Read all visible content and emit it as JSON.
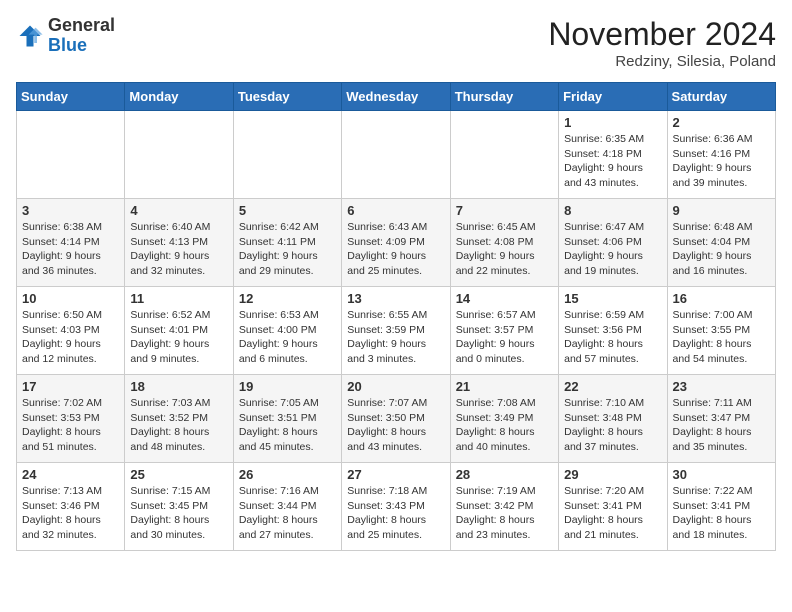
{
  "header": {
    "logo": {
      "general": "General",
      "blue": "Blue"
    },
    "title": "November 2024",
    "location": "Redziny, Silesia, Poland"
  },
  "calendar": {
    "days_of_week": [
      "Sunday",
      "Monday",
      "Tuesday",
      "Wednesday",
      "Thursday",
      "Friday",
      "Saturday"
    ],
    "weeks": [
      [
        {
          "day": "",
          "info": ""
        },
        {
          "day": "",
          "info": ""
        },
        {
          "day": "",
          "info": ""
        },
        {
          "day": "",
          "info": ""
        },
        {
          "day": "",
          "info": ""
        },
        {
          "day": "1",
          "info": "Sunrise: 6:35 AM\nSunset: 4:18 PM\nDaylight: 9 hours\nand 43 minutes."
        },
        {
          "day": "2",
          "info": "Sunrise: 6:36 AM\nSunset: 4:16 PM\nDaylight: 9 hours\nand 39 minutes."
        }
      ],
      [
        {
          "day": "3",
          "info": "Sunrise: 6:38 AM\nSunset: 4:14 PM\nDaylight: 9 hours\nand 36 minutes."
        },
        {
          "day": "4",
          "info": "Sunrise: 6:40 AM\nSunset: 4:13 PM\nDaylight: 9 hours\nand 32 minutes."
        },
        {
          "day": "5",
          "info": "Sunrise: 6:42 AM\nSunset: 4:11 PM\nDaylight: 9 hours\nand 29 minutes."
        },
        {
          "day": "6",
          "info": "Sunrise: 6:43 AM\nSunset: 4:09 PM\nDaylight: 9 hours\nand 25 minutes."
        },
        {
          "day": "7",
          "info": "Sunrise: 6:45 AM\nSunset: 4:08 PM\nDaylight: 9 hours\nand 22 minutes."
        },
        {
          "day": "8",
          "info": "Sunrise: 6:47 AM\nSunset: 4:06 PM\nDaylight: 9 hours\nand 19 minutes."
        },
        {
          "day": "9",
          "info": "Sunrise: 6:48 AM\nSunset: 4:04 PM\nDaylight: 9 hours\nand 16 minutes."
        }
      ],
      [
        {
          "day": "10",
          "info": "Sunrise: 6:50 AM\nSunset: 4:03 PM\nDaylight: 9 hours\nand 12 minutes."
        },
        {
          "day": "11",
          "info": "Sunrise: 6:52 AM\nSunset: 4:01 PM\nDaylight: 9 hours\nand 9 minutes."
        },
        {
          "day": "12",
          "info": "Sunrise: 6:53 AM\nSunset: 4:00 PM\nDaylight: 9 hours\nand 6 minutes."
        },
        {
          "day": "13",
          "info": "Sunrise: 6:55 AM\nSunset: 3:59 PM\nDaylight: 9 hours\nand 3 minutes."
        },
        {
          "day": "14",
          "info": "Sunrise: 6:57 AM\nSunset: 3:57 PM\nDaylight: 9 hours\nand 0 minutes."
        },
        {
          "day": "15",
          "info": "Sunrise: 6:59 AM\nSunset: 3:56 PM\nDaylight: 8 hours\nand 57 minutes."
        },
        {
          "day": "16",
          "info": "Sunrise: 7:00 AM\nSunset: 3:55 PM\nDaylight: 8 hours\nand 54 minutes."
        }
      ],
      [
        {
          "day": "17",
          "info": "Sunrise: 7:02 AM\nSunset: 3:53 PM\nDaylight: 8 hours\nand 51 minutes."
        },
        {
          "day": "18",
          "info": "Sunrise: 7:03 AM\nSunset: 3:52 PM\nDaylight: 8 hours\nand 48 minutes."
        },
        {
          "day": "19",
          "info": "Sunrise: 7:05 AM\nSunset: 3:51 PM\nDaylight: 8 hours\nand 45 minutes."
        },
        {
          "day": "20",
          "info": "Sunrise: 7:07 AM\nSunset: 3:50 PM\nDaylight: 8 hours\nand 43 minutes."
        },
        {
          "day": "21",
          "info": "Sunrise: 7:08 AM\nSunset: 3:49 PM\nDaylight: 8 hours\nand 40 minutes."
        },
        {
          "day": "22",
          "info": "Sunrise: 7:10 AM\nSunset: 3:48 PM\nDaylight: 8 hours\nand 37 minutes."
        },
        {
          "day": "23",
          "info": "Sunrise: 7:11 AM\nSunset: 3:47 PM\nDaylight: 8 hours\nand 35 minutes."
        }
      ],
      [
        {
          "day": "24",
          "info": "Sunrise: 7:13 AM\nSunset: 3:46 PM\nDaylight: 8 hours\nand 32 minutes."
        },
        {
          "day": "25",
          "info": "Sunrise: 7:15 AM\nSunset: 3:45 PM\nDaylight: 8 hours\nand 30 minutes."
        },
        {
          "day": "26",
          "info": "Sunrise: 7:16 AM\nSunset: 3:44 PM\nDaylight: 8 hours\nand 27 minutes."
        },
        {
          "day": "27",
          "info": "Sunrise: 7:18 AM\nSunset: 3:43 PM\nDaylight: 8 hours\nand 25 minutes."
        },
        {
          "day": "28",
          "info": "Sunrise: 7:19 AM\nSunset: 3:42 PM\nDaylight: 8 hours\nand 23 minutes."
        },
        {
          "day": "29",
          "info": "Sunrise: 7:20 AM\nSunset: 3:41 PM\nDaylight: 8 hours\nand 21 minutes."
        },
        {
          "day": "30",
          "info": "Sunrise: 7:22 AM\nSunset: 3:41 PM\nDaylight: 8 hours\nand 18 minutes."
        }
      ]
    ]
  }
}
